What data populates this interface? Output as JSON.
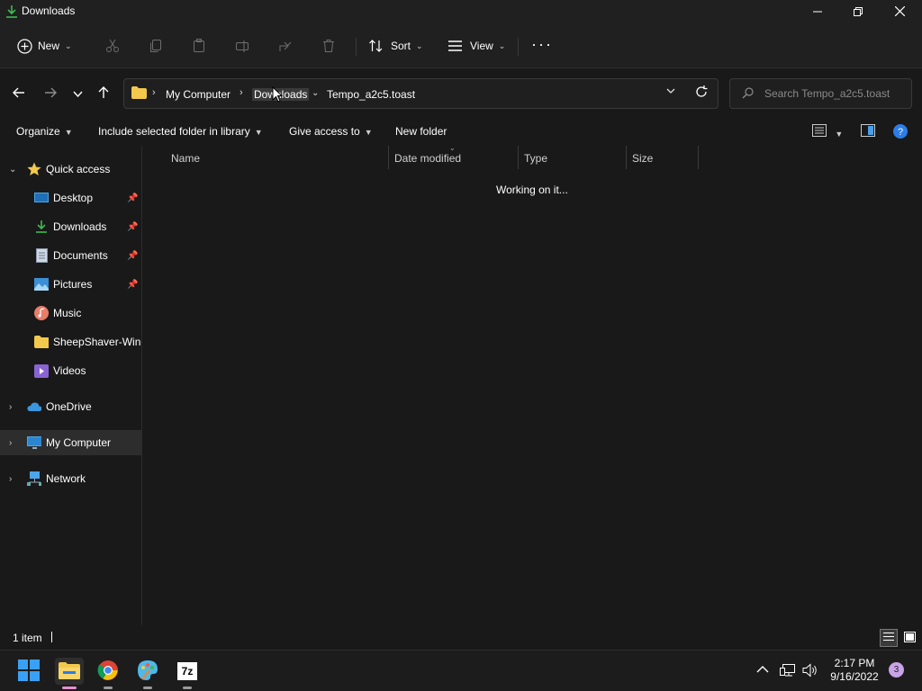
{
  "window": {
    "title": "Downloads",
    "controls": {
      "minimize": "minimize-icon",
      "maximize": "restore-icon",
      "close": "close-icon"
    }
  },
  "command_bar": {
    "new_label": "New",
    "sort_label": "Sort",
    "view_label": "View",
    "more_label": "···",
    "disabled_actions": [
      "cut",
      "copy",
      "paste",
      "rename",
      "share",
      "delete"
    ]
  },
  "address_bar": {
    "breadcrumbs": [
      "My Computer",
      "Downloads",
      "Tempo_a2c5.toast"
    ],
    "search_placeholder": "Search Tempo_a2c5.toast"
  },
  "toolbar": {
    "organize": "Organize",
    "include": "Include selected folder in library",
    "give_access": "Give access to",
    "new_folder": "New folder"
  },
  "nav_pane": {
    "quick_access": "Quick access",
    "items": [
      {
        "label": "Desktop",
        "pinned": true,
        "icon": "desktop-icon"
      },
      {
        "label": "Downloads",
        "pinned": true,
        "icon": "download-icon"
      },
      {
        "label": "Documents",
        "pinned": true,
        "icon": "document-icon"
      },
      {
        "label": "Pictures",
        "pinned": true,
        "icon": "pictures-icon"
      },
      {
        "label": "Music",
        "pinned": false,
        "icon": "music-icon"
      },
      {
        "label": "SheepShaver-Winc",
        "pinned": false,
        "icon": "folder-icon"
      },
      {
        "label": "Videos",
        "pinned": false,
        "icon": "videos-icon"
      }
    ],
    "onedrive": "OneDrive",
    "my_computer": "My Computer",
    "network": "Network"
  },
  "content": {
    "columns": [
      "Name",
      "Date modified",
      "Type",
      "Size"
    ],
    "status_message": "Working on it..."
  },
  "status_bar": {
    "item_count": "1 item"
  },
  "taskbar": {
    "apps": [
      "start-icon",
      "file-explorer-icon",
      "chrome-icon",
      "paint-icon",
      "7zip-icon"
    ],
    "sevenzip_label": "7z",
    "time": "2:17 PM",
    "date": "9/16/2022",
    "notifications": "3"
  },
  "colors": {
    "background": "#191919",
    "titlebar": "#202020",
    "accent_folder": "#f2c94c",
    "help_blue": "#2b7de9"
  }
}
